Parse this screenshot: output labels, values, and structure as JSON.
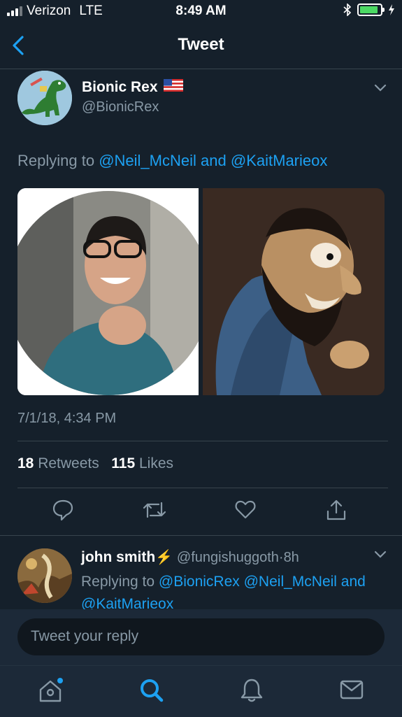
{
  "status_bar": {
    "carrier": "Verizon",
    "network": "LTE",
    "time": "8:49 AM"
  },
  "nav": {
    "title": "Tweet",
    "back_icon": "chevron-left-icon"
  },
  "tweet": {
    "author_name": "Bionic Rex",
    "author_flag": "🇺🇸",
    "handle": "@BionicRex",
    "replying_prefix": "Replying to",
    "reply_mention_1": "@Neil_McNeil",
    "reply_and": "and",
    "reply_mention_2": "@KaitMarieox",
    "timestamp": "7/1/18, 4:34 PM",
    "retweets_count": "18",
    "retweets_label": "Retweets",
    "likes_count": "115",
    "likes_label": "Likes",
    "actions": [
      "reply-icon",
      "retweet-icon",
      "like-icon",
      "share-icon"
    ]
  },
  "reply": {
    "name": "john smith",
    "name_emoji": "⚡",
    "handle": "@fungishuggoth",
    "separator": "·",
    "time": "8h",
    "replying_prefix": "Replying to",
    "mention_1": "@BionicRex",
    "mention_2": "@Neil_McNeil",
    "and_word": "and",
    "mention_3": "@KaitMarieox"
  },
  "compose": {
    "placeholder": "Tweet your reply"
  },
  "tab_bar": {
    "items": [
      "home-icon",
      "search-icon",
      "notifications-icon",
      "messages-icon"
    ],
    "active": "search-icon"
  },
  "colors": {
    "background": "#15202b",
    "accent": "#1da1f2",
    "secondary_text": "#8899a6",
    "divider": "#38444d",
    "battery": "#4cd964"
  }
}
